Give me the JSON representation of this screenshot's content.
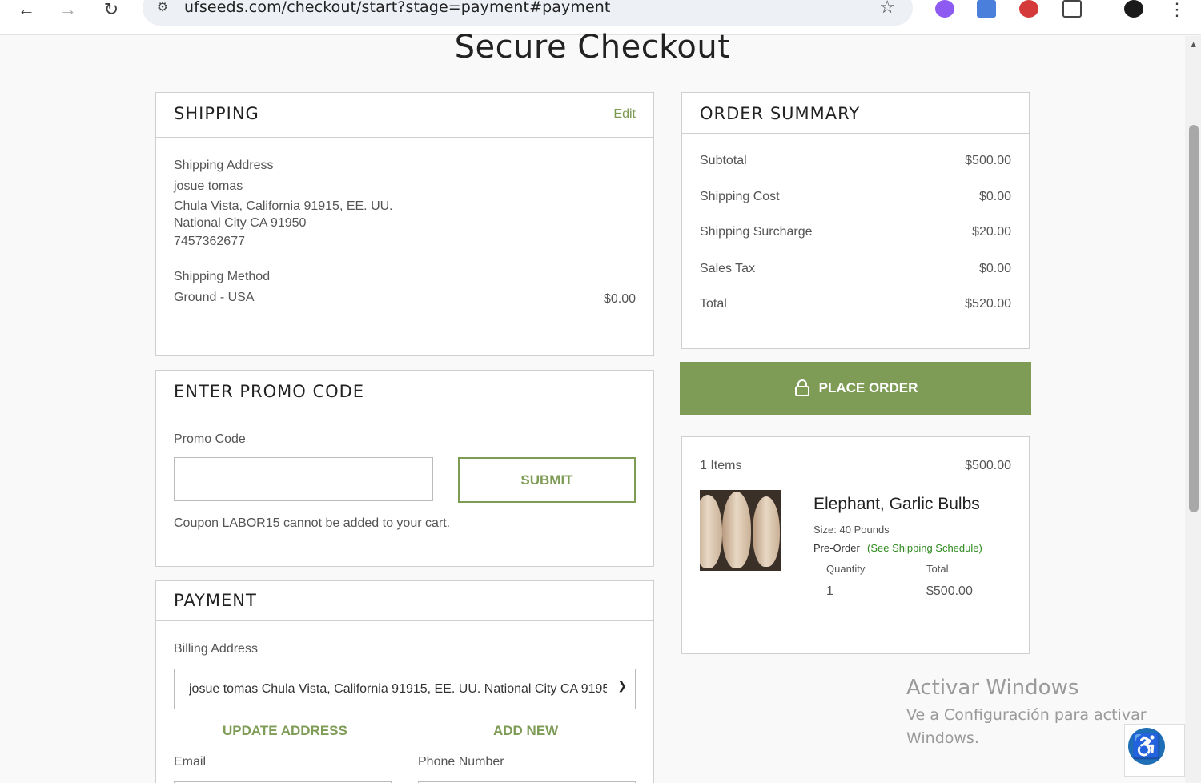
{
  "browser": {
    "url": "ufseeds.com/checkout/start?stage=payment#payment"
  },
  "page": {
    "title": "Secure Checkout"
  },
  "shipping": {
    "heading": "SHIPPING",
    "edit_label": "Edit",
    "address_label": "Shipping Address",
    "name": "josue tomas",
    "line1": "Chula Vista, California 91915, EE. UU.",
    "line2": "National City CA 91950",
    "phone": "7457362677",
    "method_label": "Shipping Method",
    "method": "Ground - USA",
    "method_price": "$0.00"
  },
  "promo": {
    "heading": "ENTER PROMO CODE",
    "field_label": "Promo Code",
    "value": "",
    "submit_label": "SUBMIT",
    "message": "Coupon LABOR15 cannot be added to your cart."
  },
  "payment": {
    "heading": "PAYMENT",
    "billing_label": "Billing Address",
    "billing_selected": "josue tomas Chula Vista, California 91915, EE. UU. National City CA 9195",
    "update_label": "UPDATE ADDRESS",
    "add_new_label": "ADD NEW",
    "email_label": "Email",
    "phone_label": "Phone Number"
  },
  "summary": {
    "heading": "ORDER SUMMARY",
    "rows": [
      {
        "label": "Subtotal",
        "value": "$500.00"
      },
      {
        "label": "Shipping Cost",
        "value": "$0.00"
      },
      {
        "label": "Shipping Surcharge",
        "value": "$20.00"
      },
      {
        "label": "Sales Tax",
        "value": "$0.00"
      },
      {
        "label": "Total",
        "value": "$520.00"
      }
    ],
    "place_order_label": "PLACE ORDER"
  },
  "cart": {
    "items_label": "1 Items",
    "items_total": "$500.00",
    "product_name": "Elephant, Garlic Bulbs",
    "size": "Size: 40 Pounds",
    "preorder": "Pre-Order",
    "schedule_link": "(See Shipping Schedule)",
    "qty_label": "Quantity",
    "total_label": "Total",
    "qty": "1",
    "line_total": "$500.00"
  },
  "watermark": {
    "line1": "Activar Windows",
    "line2": "Ve a Configuración para activar",
    "line3": "Windows."
  },
  "colors": {
    "accent": "#7f9c57",
    "link_green": "#2e8b1e"
  },
  "icons": {
    "back": "arrow-left-icon",
    "forward": "arrow-right-icon",
    "reload": "reload-icon",
    "bookmark": "star-icon",
    "lock": "lock-icon",
    "menu": "kebab-menu-icon",
    "accessibility": "accessibility-icon"
  }
}
